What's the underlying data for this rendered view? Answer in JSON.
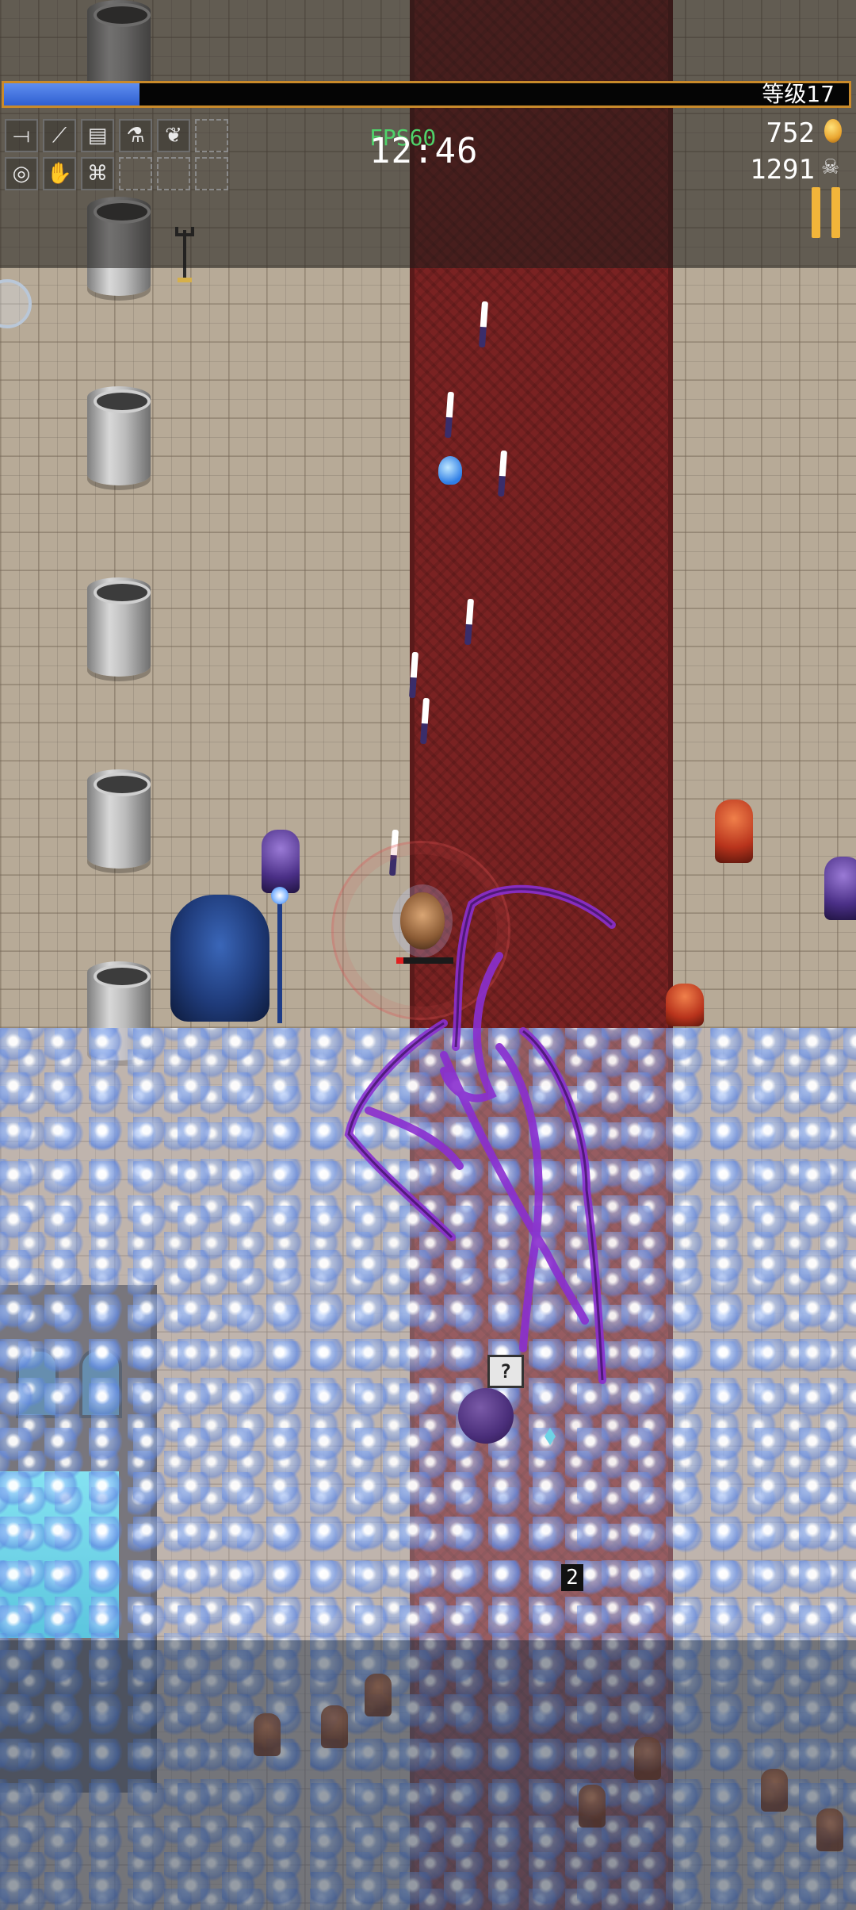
{
  "hud": {
    "level_label": "等级17",
    "xp_progress": 0.16,
    "fps_label": "FPS60",
    "timer": "12:46",
    "coins": "752",
    "kills": "1291"
  },
  "inventory": {
    "weapons": [
      "knife-icon",
      "whip-icon",
      "bible-icon",
      "potion-icon",
      "laurel-icon",
      "empty-slot"
    ],
    "passives": [
      "ring-icon",
      "gauntlet-icon",
      "candelabra-icon",
      "empty-slot",
      "empty-slot",
      "empty-slot"
    ]
  },
  "pickups": {
    "chest_label": "?",
    "counter_tag": "2"
  },
  "colors": {
    "xp_fill": "#2f5fd0",
    "xp_border": "#c98a2a",
    "fps": "#4fd26a",
    "pause": "#f2b53a",
    "carpet": "#7a2222",
    "tentacle": "#8a2fd0"
  }
}
